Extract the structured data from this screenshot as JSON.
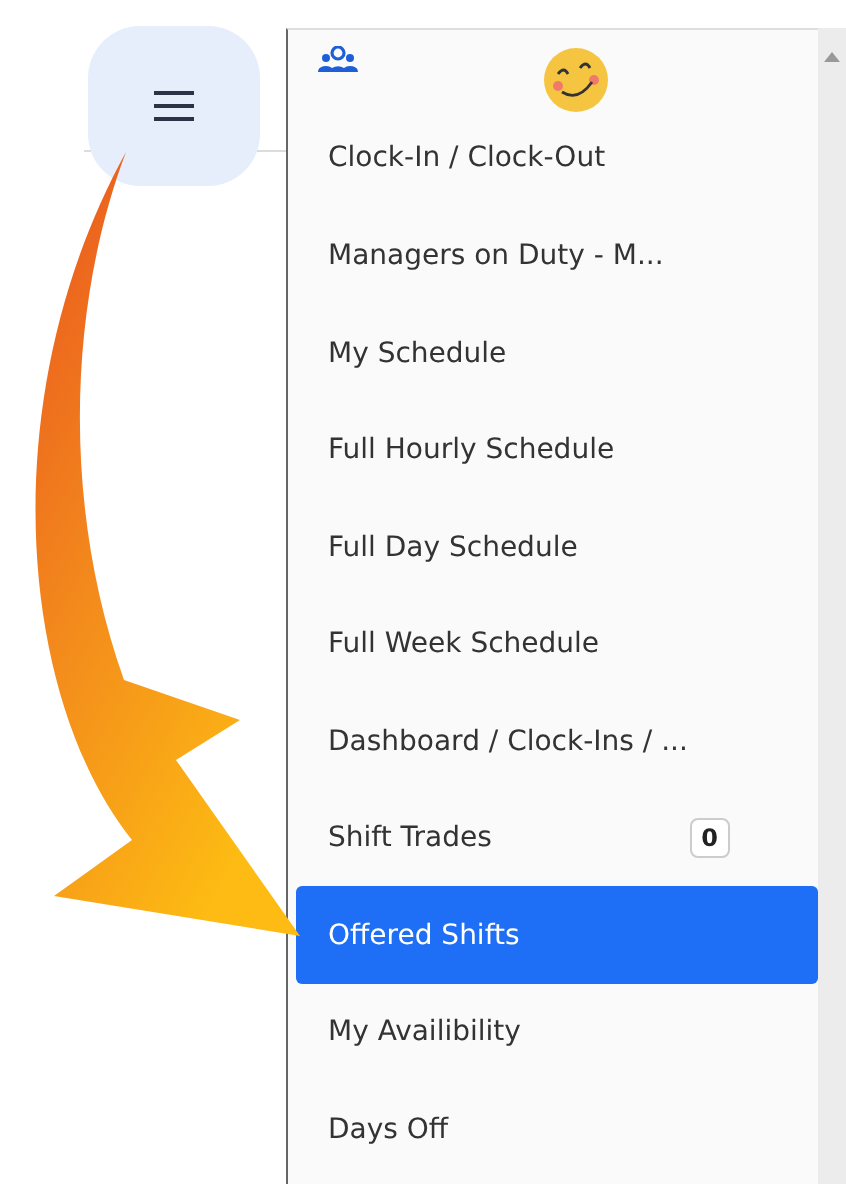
{
  "menu": {
    "items": [
      {
        "label": "Clock-In / Clock-Out",
        "selected": false
      },
      {
        "label": "Managers on Duty - M...",
        "selected": false
      },
      {
        "label": "My Schedule",
        "selected": false
      },
      {
        "label": "Full Hourly Schedule",
        "selected": false
      },
      {
        "label": "Full Day Schedule",
        "selected": false
      },
      {
        "label": "Full Week Schedule",
        "selected": false
      },
      {
        "label": "Dashboard / Clock-Ins / ...",
        "selected": false
      },
      {
        "label": "Shift Trades",
        "selected": false,
        "badge": "0"
      },
      {
        "label": "Offered Shifts",
        "selected": true
      },
      {
        "label": "My Availibility",
        "selected": false
      },
      {
        "label": "Days Off",
        "selected": false
      }
    ]
  }
}
